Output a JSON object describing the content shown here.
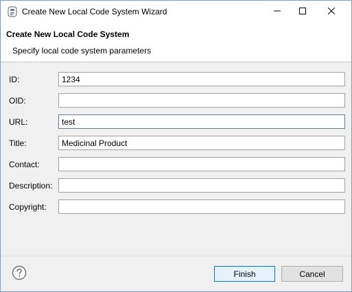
{
  "window": {
    "title": "Create New Local Code System Wizard"
  },
  "header": {
    "title": "Create New Local Code System",
    "subtitle": "Specify local code system parameters"
  },
  "form": {
    "id": {
      "label": "ID:",
      "value": "1234"
    },
    "oid": {
      "label": "OID:",
      "value": ""
    },
    "url": {
      "label": "URL:",
      "value": "test"
    },
    "title": {
      "label": "Title:",
      "value": "Medicinal Product"
    },
    "contact": {
      "label": "Contact:",
      "value": ""
    },
    "description": {
      "label": "Description:",
      "value": ""
    },
    "copyright": {
      "label": "Copyright:",
      "value": ""
    }
  },
  "buttons": {
    "finish": "Finish",
    "cancel": "Cancel"
  },
  "icons": {
    "app": "wizard-app-icon",
    "help": "help-icon",
    "minimize": "minimize-icon",
    "maximize": "maximize-icon",
    "close": "close-icon"
  },
  "colors": {
    "default_button_border": "#0078d7",
    "default_button_fill": "#e5f1fb",
    "dialog_background": "#f0f0f0"
  }
}
